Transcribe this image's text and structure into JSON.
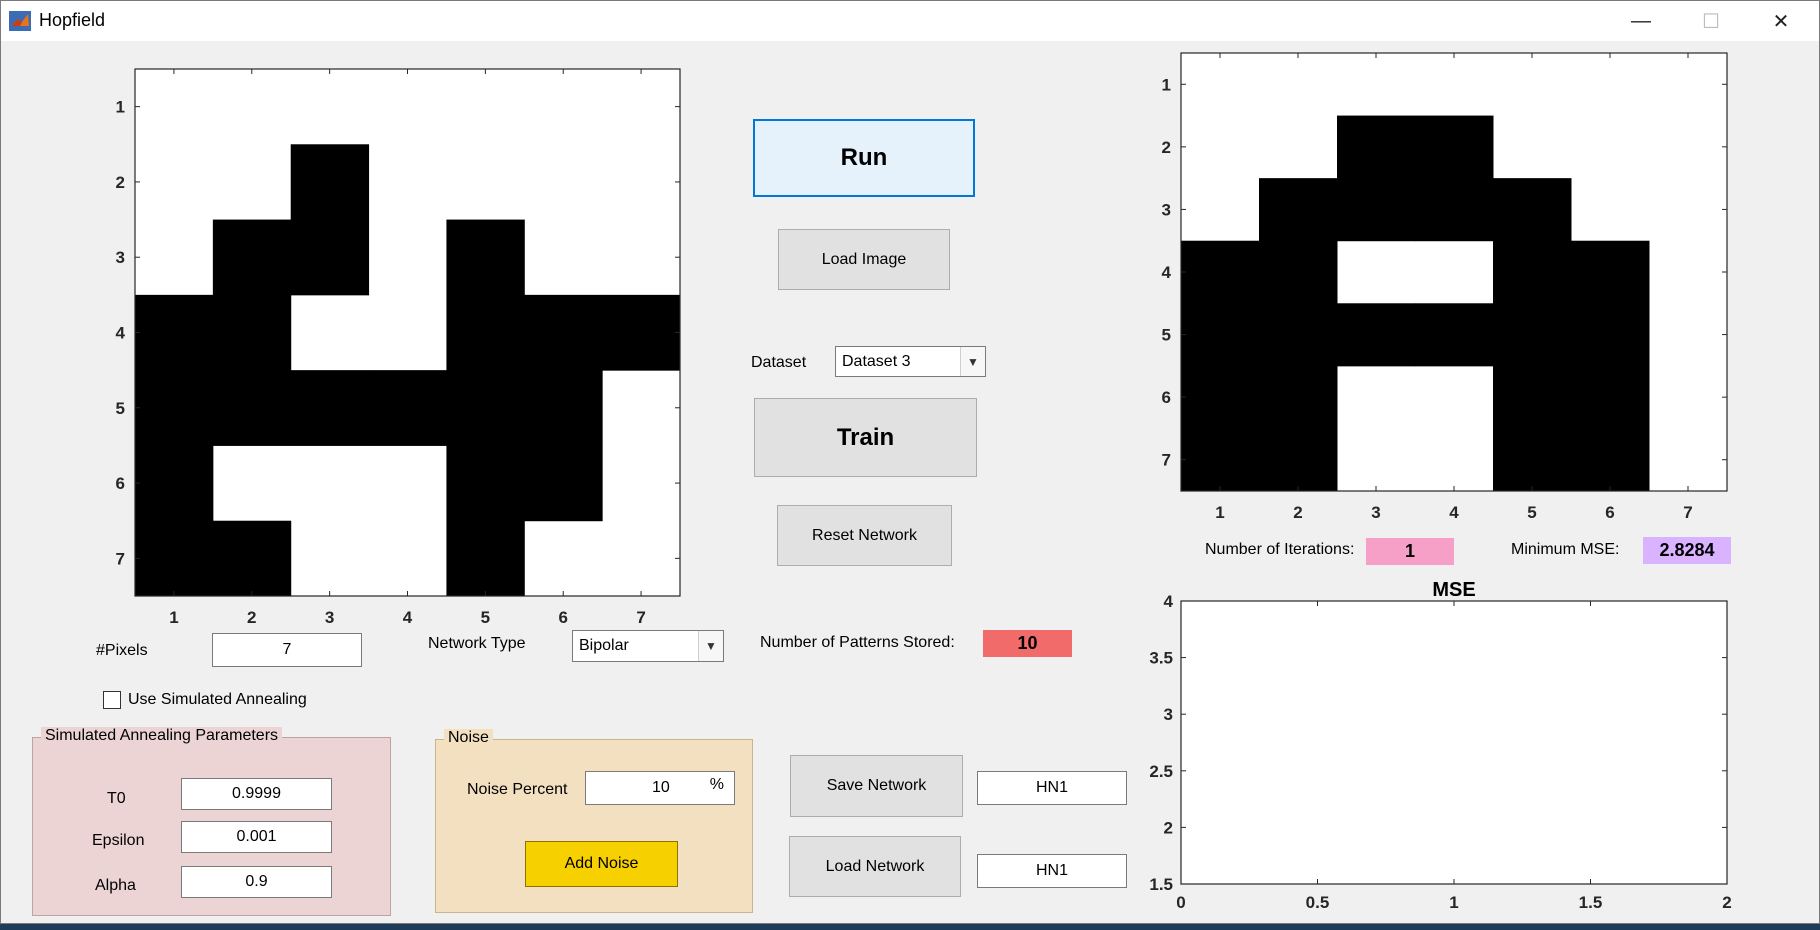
{
  "window": {
    "title": "Hopfield",
    "controls": {
      "minimize": "—",
      "maximize": "☐",
      "close": "✕"
    }
  },
  "input_grid": {
    "x_ticks": [
      "1",
      "2",
      "3",
      "4",
      "5",
      "6",
      "7"
    ],
    "y_ticks": [
      "1",
      "2",
      "3",
      "4",
      "5",
      "6",
      "7"
    ],
    "cells": [
      [
        0,
        0,
        0,
        0,
        0,
        0,
        0
      ],
      [
        0,
        0,
        1,
        0,
        0,
        0,
        0
      ],
      [
        0,
        1,
        1,
        0,
        1,
        0,
        0
      ],
      [
        1,
        1,
        0,
        0,
        1,
        1,
        1
      ],
      [
        1,
        1,
        1,
        1,
        1,
        1,
        0
      ],
      [
        1,
        0,
        0,
        0,
        1,
        1,
        0
      ],
      [
        1,
        1,
        0,
        0,
        1,
        0,
        0
      ]
    ]
  },
  "output_grid": {
    "x_ticks": [
      "1",
      "2",
      "3",
      "4",
      "5",
      "6",
      "7"
    ],
    "y_ticks": [
      "1",
      "2",
      "3",
      "4",
      "5",
      "6",
      "7"
    ],
    "cells": [
      [
        0,
        0,
        0,
        0,
        0,
        0,
        0
      ],
      [
        0,
        0,
        1,
        1,
        0,
        0,
        0
      ],
      [
        0,
        1,
        1,
        1,
        1,
        0,
        0
      ],
      [
        1,
        1,
        0,
        0,
        1,
        1,
        0
      ],
      [
        1,
        1,
        1,
        1,
        1,
        1,
        0
      ],
      [
        1,
        1,
        0,
        0,
        1,
        1,
        0
      ],
      [
        1,
        1,
        0,
        0,
        1,
        1,
        0
      ]
    ]
  },
  "buttons": {
    "run": "Run",
    "load_image": "Load Image",
    "train": "Train",
    "reset_network": "Reset Network",
    "save_network": "Save Network",
    "load_network": "Load Network",
    "add_noise": "Add Noise"
  },
  "dataset": {
    "label": "Dataset",
    "selected": "Dataset 3"
  },
  "pixels": {
    "label": "#Pixels",
    "value": "7"
  },
  "network_type": {
    "label": "Network Type",
    "selected": "Bipolar"
  },
  "patterns": {
    "label": "Number of Patterns Stored:",
    "value": "10"
  },
  "simulated_annealing_checkbox": {
    "label": "Use Simulated Annealing",
    "checked": false
  },
  "sa_panel": {
    "title": "Simulated Annealing Parameters",
    "t0_label": "T0",
    "t0_value": "0.9999",
    "epsilon_label": "Epsilon",
    "epsilon_value": "0.001",
    "alpha_label": "Alpha",
    "alpha_value": "0.9"
  },
  "noise_panel": {
    "title": "Noise",
    "percent_label": "Noise Percent",
    "percent_value": "10",
    "percent_unit": "%"
  },
  "save_network_name": "HN1",
  "load_network_name": "HN1",
  "iterations": {
    "label": "Number of Iterations:",
    "value": "1"
  },
  "min_mse": {
    "label": "Minimum MSE:",
    "value": "2.8284"
  },
  "colors": {
    "patterns_badge": "#f26b6b",
    "iterations_badge": "#f6a0c8",
    "mse_badge": "#d9b3ff",
    "sa_panel_bg": "#ecd4d4",
    "noise_panel_bg": "#f3e0c0",
    "add_noise_bg": "#f7d000",
    "run_bg": "#e5f1fb"
  },
  "chart_data": {
    "type": "line",
    "title": "MSE",
    "xlabel": "",
    "ylabel": "",
    "xlim": [
      0,
      2
    ],
    "ylim": [
      1.5,
      4
    ],
    "x_ticks": [
      "0",
      "0.5",
      "1",
      "1.5",
      "2"
    ],
    "y_ticks": [
      "1.5",
      "2",
      "2.5",
      "3",
      "3.5",
      "4"
    ],
    "series": [
      {
        "x": [],
        "y": []
      }
    ],
    "grid": false
  }
}
